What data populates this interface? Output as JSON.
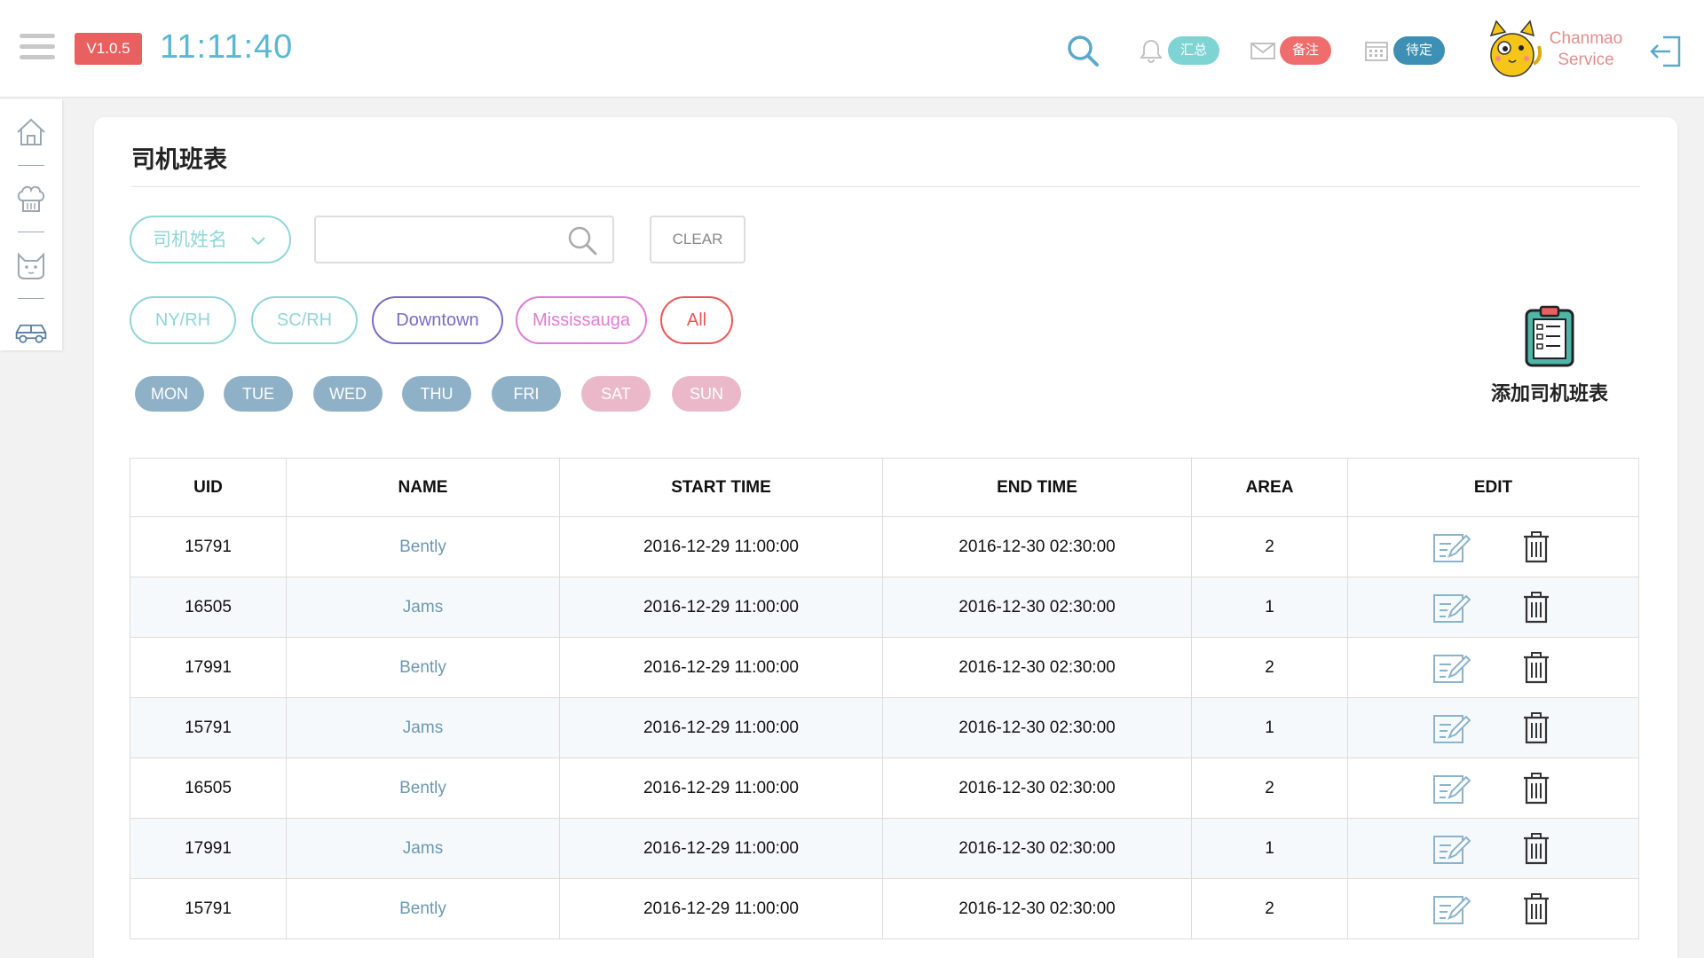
{
  "header": {
    "version": "V1.0.5",
    "clock": "11:11:40",
    "badges": {
      "summary": "汇总",
      "notes": "备注",
      "pending": "待定"
    },
    "user_name": "Chanmao Service"
  },
  "sidebar": {
    "items": [
      {
        "icon": "home-icon"
      },
      {
        "icon": "chef-hat-icon"
      },
      {
        "icon": "cat-face-icon"
      },
      {
        "icon": "car-icon"
      }
    ]
  },
  "page": {
    "title": "司机班表",
    "filter_select_label": "司机姓名",
    "search_placeholder": "",
    "clear_label": "CLEAR",
    "add_label": "添加司机班表"
  },
  "areas": [
    {
      "label": "NY/RH",
      "color": "#8fd6d8"
    },
    {
      "label": "SC/RH",
      "color": "#8fd6d8"
    },
    {
      "label": "Downtown",
      "color": "#7a6bc8"
    },
    {
      "label": "Mississauga",
      "color": "#e07ad6"
    },
    {
      "label": "All",
      "color": "#ee5454"
    }
  ],
  "days": [
    {
      "label": "MON",
      "color": "#8fb1c8"
    },
    {
      "label": "TUE",
      "color": "#8fb1c8"
    },
    {
      "label": "WED",
      "color": "#8fb1c8"
    },
    {
      "label": "THU",
      "color": "#8fb1c8"
    },
    {
      "label": "FRI",
      "color": "#8fb1c8"
    },
    {
      "label": "SAT",
      "color": "#eab8c8"
    },
    {
      "label": "SUN",
      "color": "#eab8c8"
    }
  ],
  "table": {
    "columns": [
      "UID",
      "NAME",
      "START TIME",
      "END TIME",
      "AREA",
      "EDIT"
    ],
    "rows": [
      {
        "uid": "15791",
        "name": "Bently",
        "start": "2016-12-29 11:00:00",
        "end": "2016-12-30 02:30:00",
        "area": "2"
      },
      {
        "uid": "16505",
        "name": "Jams",
        "start": "2016-12-29 11:00:00",
        "end": "2016-12-30 02:30:00",
        "area": "1"
      },
      {
        "uid": "17991",
        "name": "Bently",
        "start": "2016-12-29 11:00:00",
        "end": "2016-12-30 02:30:00",
        "area": "2"
      },
      {
        "uid": "15791",
        "name": "Jams",
        "start": "2016-12-29 11:00:00",
        "end": "2016-12-30 02:30:00",
        "area": "1"
      },
      {
        "uid": "16505",
        "name": "Bently",
        "start": "2016-12-29 11:00:00",
        "end": "2016-12-30 02:30:00",
        "area": "2"
      },
      {
        "uid": "17991",
        "name": "Jams",
        "start": "2016-12-29 11:00:00",
        "end": "2016-12-30 02:30:00",
        "area": "1"
      },
      {
        "uid": "15791",
        "name": "Bently",
        "start": "2016-12-29 11:00:00",
        "end": "2016-12-30 02:30:00",
        "area": "2"
      }
    ]
  }
}
